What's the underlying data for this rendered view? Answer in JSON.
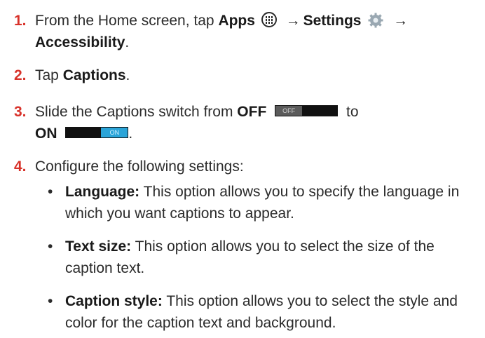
{
  "steps": {
    "s1": {
      "num": "1.",
      "pre": "From the Home screen, tap ",
      "apps": "Apps",
      "arrow1": "→",
      "settings": "Settings",
      "arrow2": "→",
      "accessibility": "Accessibility",
      "end": "."
    },
    "s2": {
      "num": "2.",
      "pre": "Tap ",
      "captions": "Captions",
      "end": "."
    },
    "s3": {
      "num": "3.",
      "pre": "Slide the Captions switch from ",
      "off": "OFF",
      "off_switch_label": "OFF",
      "mid": "to",
      "on": "ON",
      "on_switch_label": "ON",
      "end": "."
    },
    "s4": {
      "num": "4.",
      "text": "Configure the following settings:"
    }
  },
  "bullets": [
    {
      "dot": "•",
      "term": "Language:",
      "desc": "This option allows you to specify the language in which you want captions to appear."
    },
    {
      "dot": "•",
      "term": "Text size:",
      "desc": "This option allows you to  select the size of the caption text."
    },
    {
      "dot": "•",
      "term": "Caption style:",
      "desc": "This option allows you to select the style and color for the caption text and background."
    }
  ],
  "colors": {
    "step_number": "#d8322a",
    "switch_on": "#2aa4d8",
    "switch_off": "#5b5b5b"
  },
  "icons": {
    "apps": "apps-grid-icon",
    "settings": "gear-icon"
  }
}
